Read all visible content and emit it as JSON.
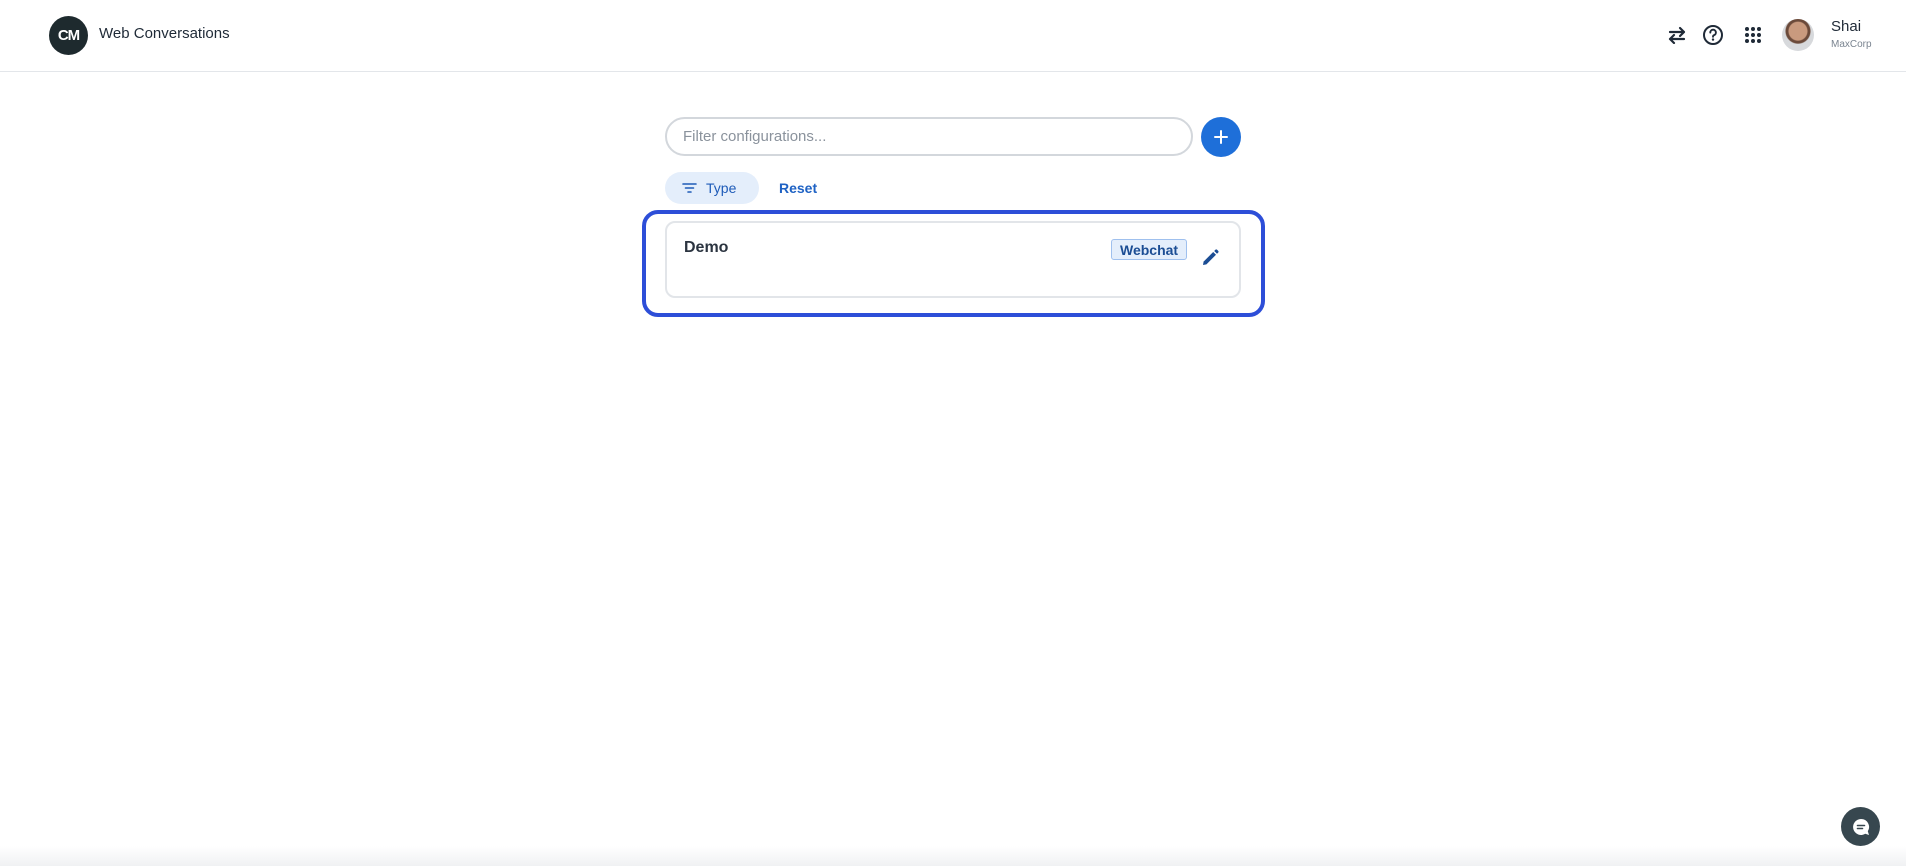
{
  "app": {
    "logo_text": "CM",
    "title": "Web Conversations"
  },
  "header": {
    "icons": [
      "swap-arrows-icon",
      "help-circle-icon",
      "apps-grid-icon"
    ],
    "user": {
      "name": "Shai",
      "org": "MaxCorp"
    }
  },
  "search": {
    "placeholder": "Filter configurations...",
    "value": ""
  },
  "filters": {
    "type_label": "Type",
    "reset_label": "Reset"
  },
  "configurations": [
    {
      "name": "Demo",
      "badge": "Webchat"
    }
  ],
  "colors": {
    "accent": "#1e6fd9",
    "highlight_border": "#2d4ed8",
    "chip_bg": "#e4eefb",
    "logo_bg": "#1e2a2e",
    "chat_button_bg": "#37474f"
  }
}
